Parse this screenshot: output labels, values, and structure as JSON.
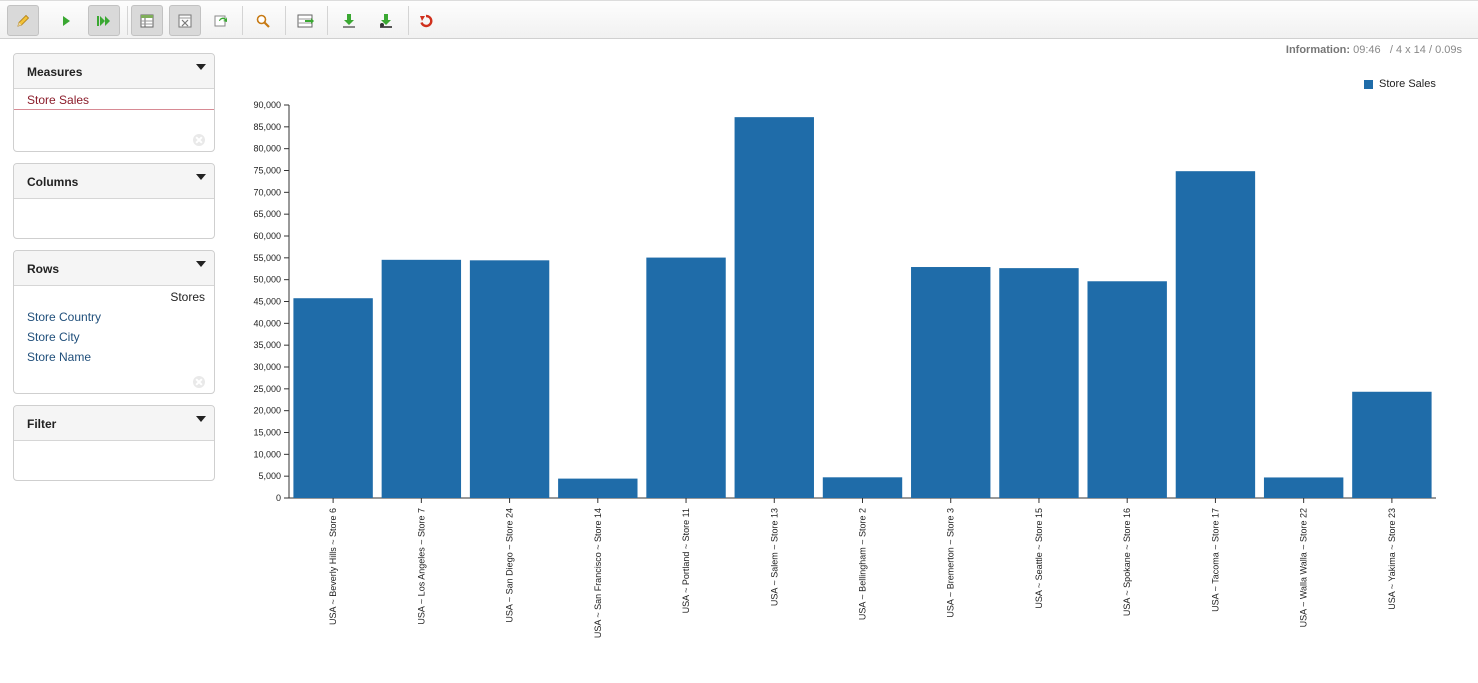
{
  "toolbar": {
    "buttons": [
      {
        "name": "edit-button",
        "icon": "pencil-icon"
      },
      {
        "name": "run-button",
        "icon": "play-icon"
      },
      {
        "name": "auto-run-button",
        "icon": "fast-forward-icon"
      },
      {
        "name": "toggle-fields-button",
        "icon": "table-fields-icon"
      },
      {
        "name": "hide-empty-button",
        "icon": "empty-table-icon"
      },
      {
        "name": "swap-axis-button",
        "icon": "swap-axis-icon"
      },
      {
        "name": "drillthrough-button",
        "icon": "magnifier-icon"
      },
      {
        "name": "export-button",
        "icon": "export-table-icon"
      },
      {
        "name": "download-button",
        "icon": "download-icon"
      },
      {
        "name": "download-alt-button",
        "icon": "download-alt-icon"
      },
      {
        "name": "undo-button",
        "icon": "undo-icon"
      }
    ]
  },
  "sidebar": {
    "measures": {
      "title": "Measures",
      "items": [
        "Store Sales"
      ]
    },
    "columns": {
      "title": "Columns"
    },
    "rows": {
      "title": "Rows",
      "dimension": "Stores",
      "levels": [
        "Store Country",
        "Store City",
        "Store Name"
      ]
    },
    "filter": {
      "title": "Filter"
    }
  },
  "info": {
    "label": "Information:",
    "time": "09:46",
    "size": "/ 4 x 14",
    "duration": "/ 0.09s"
  },
  "colors": {
    "bar": "#1f6ca9",
    "accent_red": "#8b1c2a",
    "link_blue": "#1f4e7a"
  },
  "chart_data": {
    "type": "bar",
    "categories": [
      "USA ~ Beverly Hills ~ Store 6",
      "USA ~ Los Angeles ~ Store 7",
      "USA ~ San Diego ~ Store 24",
      "USA ~ San Francisco ~ Store 14",
      "USA ~ Portland ~ Store 11",
      "USA ~ Salem ~ Store 13",
      "USA ~ Bellingham ~ Store 2",
      "USA ~ Bremerton ~ Store 3",
      "USA ~ Seattle ~ Store 15",
      "USA ~ Spokane ~ Store 16",
      "USA ~ Tacoma ~ Store 17",
      "USA ~ Walla Walla ~ Store 22",
      "USA ~ Yakima ~ Store 23"
    ],
    "series": [
      {
        "name": "Store Sales",
        "values": [
          45750,
          54545,
          54431,
          4441,
          55059,
          87218,
          4739,
          52896,
          52644,
          49634,
          74843,
          4706,
          24329
        ]
      }
    ],
    "yticks": [
      "0",
      "5,000",
      "10,000",
      "15,000",
      "20,000",
      "25,000",
      "30,000",
      "35,000",
      "40,000",
      "45,000",
      "50,000",
      "55,000",
      "60,000",
      "65,000",
      "70,000",
      "75,000",
      "80,000",
      "85,000",
      "90,000"
    ],
    "ylim": [
      0,
      90000
    ],
    "legend": "top-right",
    "grid": false
  }
}
